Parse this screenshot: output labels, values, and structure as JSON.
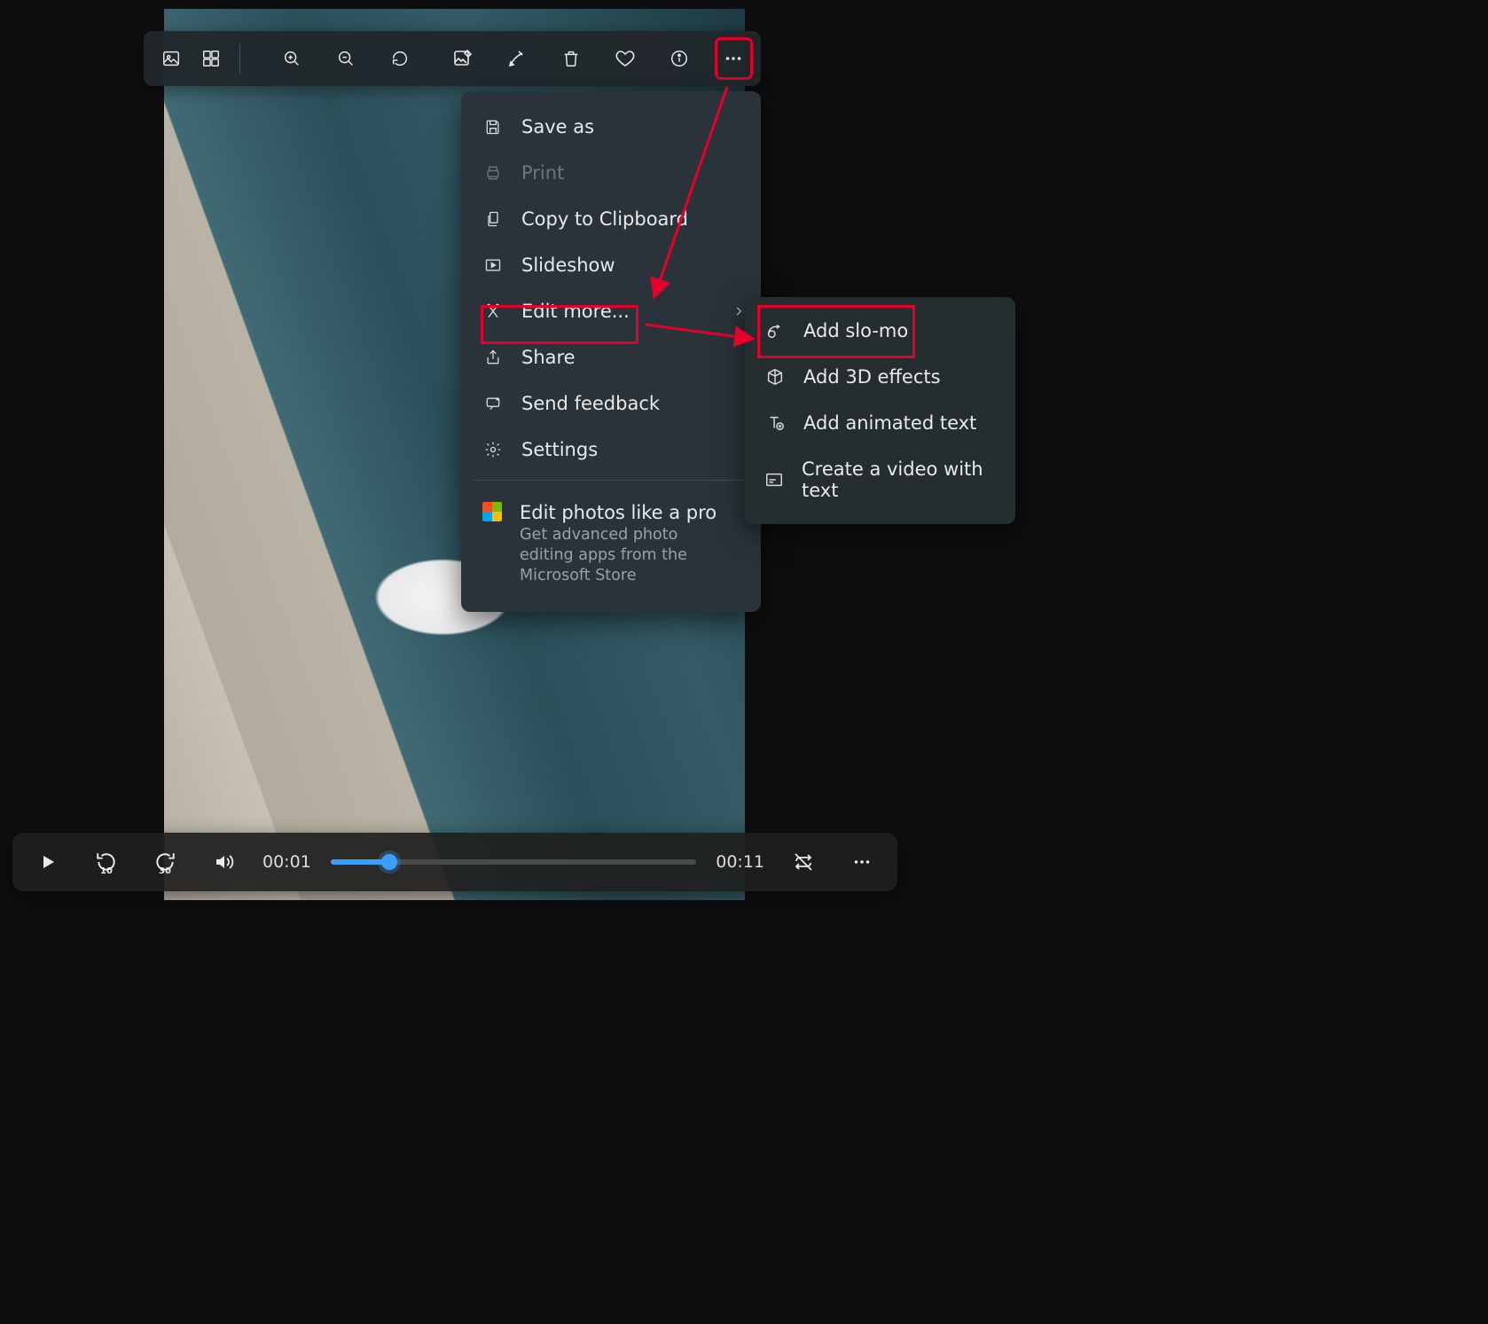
{
  "toolbar": {
    "icons": {
      "gallery": "gallery-icon",
      "collection": "collection-icon",
      "zoom_in": "zoom-in-icon",
      "zoom_out": "zoom-out-icon",
      "rotate": "rotate-icon",
      "edit_image": "edit-image-icon",
      "draw": "draw-icon",
      "delete": "delete-icon",
      "favorite": "heart-icon",
      "info": "info-icon",
      "more": "more-icon"
    }
  },
  "dropdown": {
    "save_as": "Save as",
    "print": "Print",
    "copy": "Copy to Clipboard",
    "slideshow": "Slideshow",
    "edit_more": "Edit more...",
    "share": "Share",
    "send_feedback": "Send feedback",
    "settings": "Settings",
    "store_title": "Edit photos like a pro",
    "store_sub": "Get advanced photo editing apps from the Microsoft Store"
  },
  "submenu": {
    "slomo": "Add slo-mo",
    "effects3d": "Add 3D effects",
    "animated_text": "Add animated text",
    "video_text": "Create a video with text"
  },
  "playbar": {
    "skip_back_amount": "10",
    "skip_fwd_amount": "30",
    "elapsed": "00:01",
    "total": "00:11",
    "progress_percent": 16
  },
  "colors": {
    "annotation_red": "#e4002b",
    "accent_blue": "#3aa0ff"
  }
}
